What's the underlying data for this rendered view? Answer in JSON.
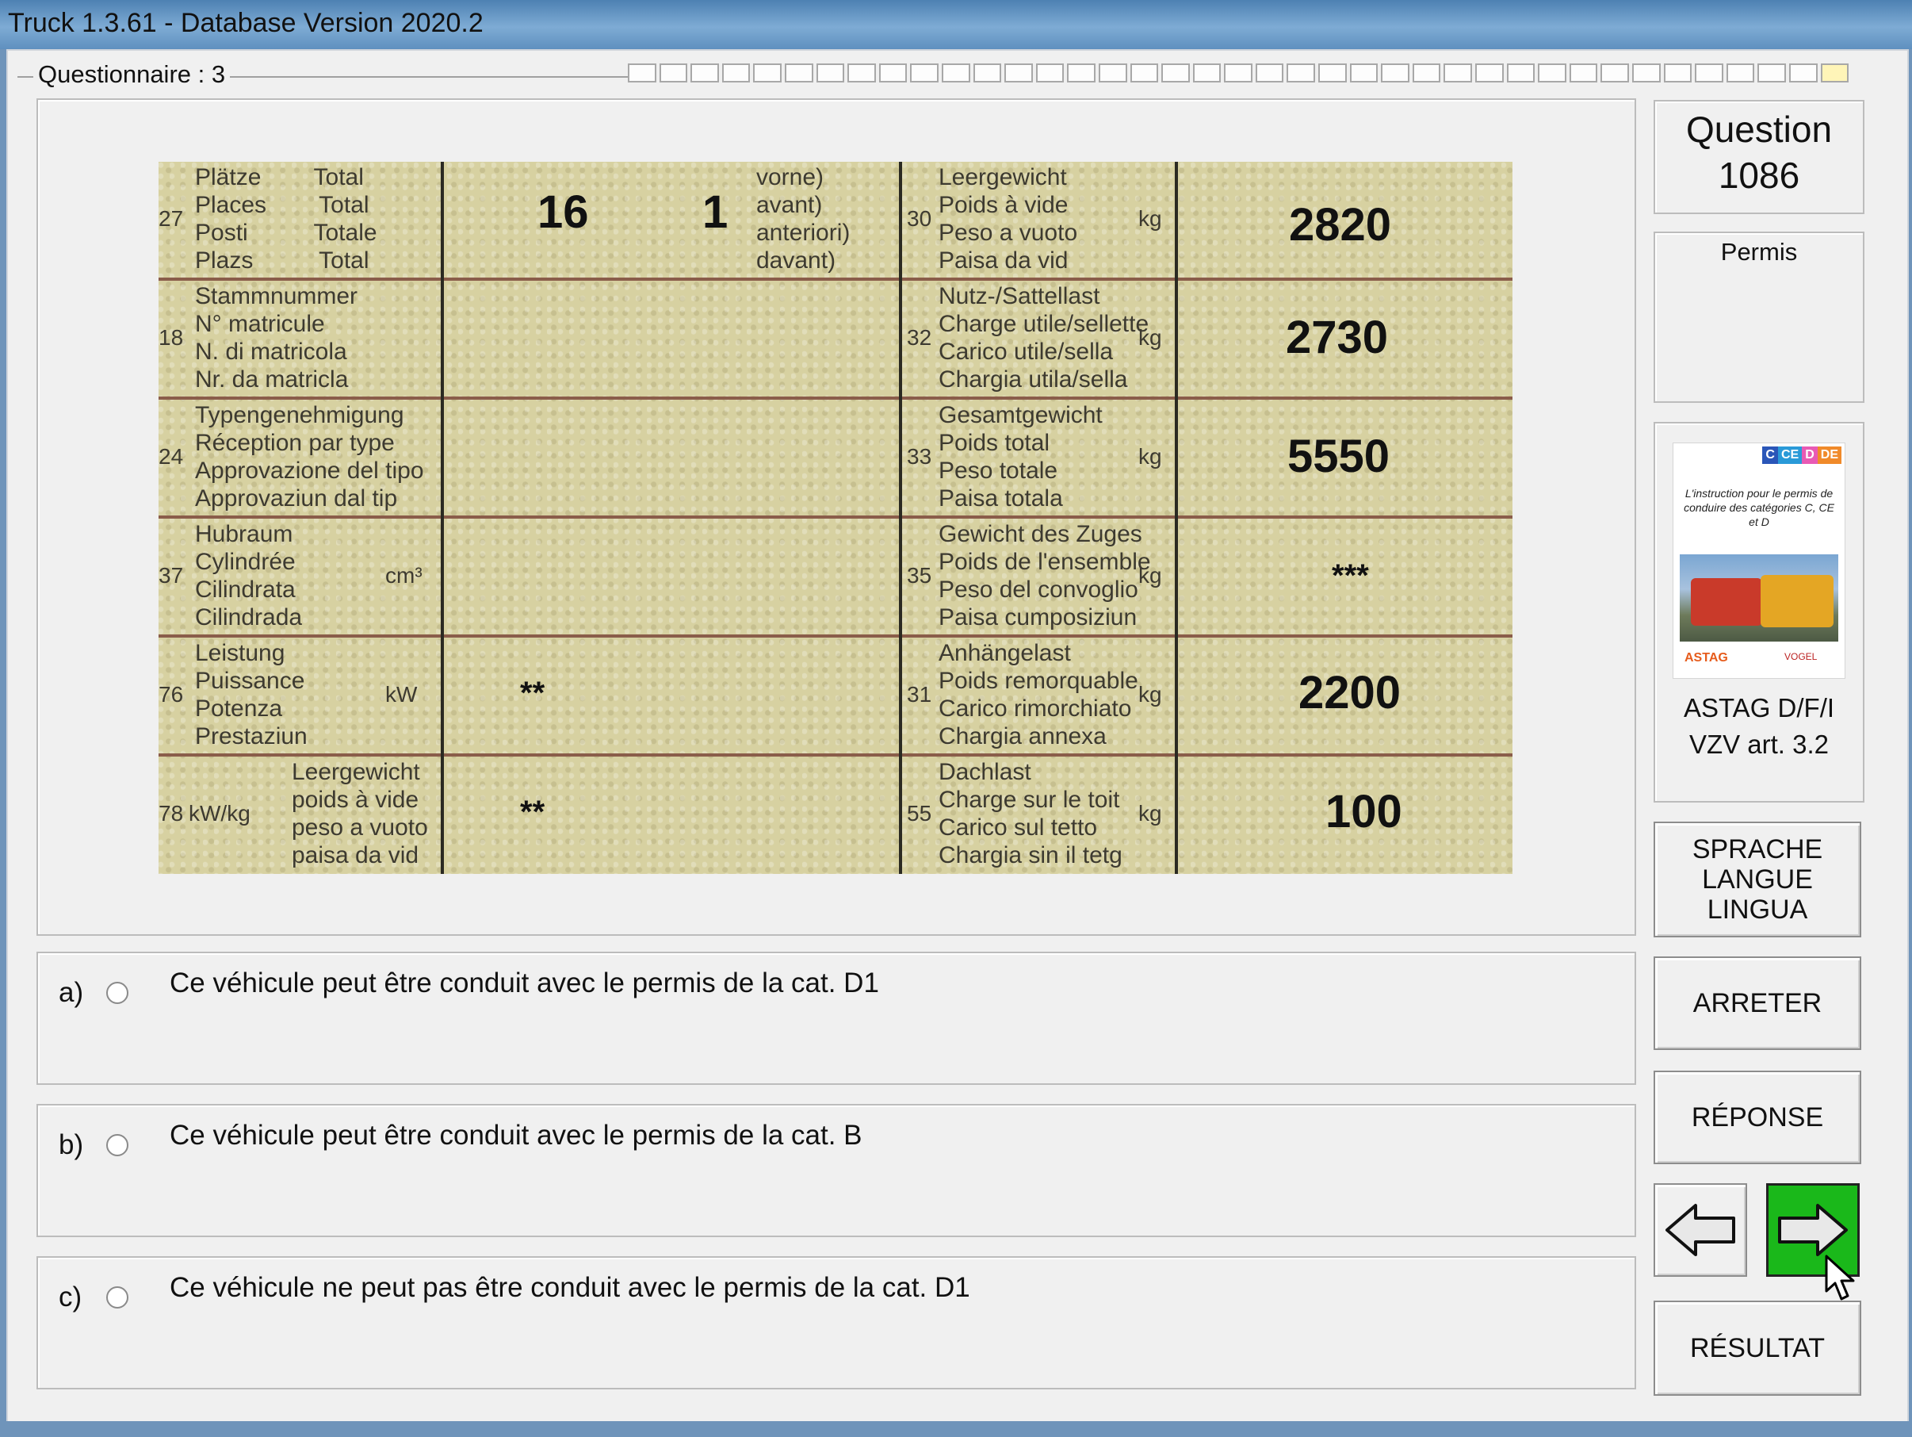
{
  "window": {
    "title": "Truck 1.3.61 - Database Version 2020.2"
  },
  "questionnaire": {
    "label": "Questionnaire : 3",
    "progress_total": 39,
    "progress_done": 1
  },
  "document": {
    "rows": [
      {
        "num": "27",
        "label": "Plätze        Total\nPlaces        Total\nPosti          Totale\nPlazs          Total",
        "value_a": "16",
        "value_b": "1",
        "value_b_label": "vorne)\navant)\nanteriori)\ndavant)",
        "num_r": "30",
        "label_r": "Leergewicht\nPoids à vide\nPeso a vuoto\nPaisa da vid",
        "unit_r": "kg",
        "value_r": "2820"
      },
      {
        "num": "18",
        "label": "Stammnummer\nN° matricule\nN. di matricola\nNr. da matricla",
        "num_r": "32",
        "label_r": "Nutz-/Sattellast\nCharge utile/sellette\nCarico utile/sella\nChargia utila/sella",
        "unit_r": "kg",
        "value_r": "2730"
      },
      {
        "num": "24",
        "label": "Typengenehmigung\nRéception par type\nApprovazione del tipo\nApprovaziun dal tip",
        "num_r": "33",
        "label_r": "Gesamtgewicht\nPoids total\nPeso totale\nPaisa totala",
        "unit_r": "kg",
        "value_r": "5550"
      },
      {
        "num": "37",
        "label": "Hubraum\nCylindrée\nCilindrata\nCilindrada",
        "unit": "cm³",
        "num_r": "35",
        "label_r": "Gewicht des Zuges\nPoids de l'ensemble\nPeso del convoglio\nPaisa cumposiziun",
        "unit_r": "kg",
        "value_r": "***"
      },
      {
        "num": "76",
        "label": "Leistung\nPuissance\nPotenza\nPrestaziun",
        "unit": "kW",
        "value_a": "**",
        "num_r": "31",
        "label_r": "Anhängelast\nPoids remorquable\nCarico rimorchiato\nChargia annexa",
        "unit_r": "kg",
        "value_r": "2200"
      },
      {
        "num": "78",
        "label_prefix": "kW/kg",
        "label": "Leergewicht\npoids à vide\npeso a vuoto\npaisa da vid",
        "value_a": "**",
        "num_r": "55",
        "label_r": "Dachlast\nCharge sur le toit\nCarico sul tetto\nChargia sin il tetg",
        "unit_r": "kg",
        "value_r": "100"
      }
    ]
  },
  "answers": [
    {
      "letter": "a)",
      "text": "Ce véhicule peut être conduit avec le permis de la cat. D1"
    },
    {
      "letter": "b)",
      "text": "Ce véhicule peut être conduit avec le permis de la cat. B"
    },
    {
      "letter": "c)",
      "text": "Ce véhicule ne peut pas être conduit avec le permis de la cat. D1"
    }
  ],
  "sidebar": {
    "question_label": "Question",
    "question_number": "1086",
    "category_label": "Permis",
    "book": {
      "badges": [
        "C",
        "CE",
        "D",
        "DE"
      ],
      "badge_colors": [
        "#2a56b8",
        "#2a9ad8",
        "#e85ab4",
        "#f08a2a"
      ],
      "text": "L'instruction pour le permis de conduire des catégories C, CE et D",
      "logo_left": "ASTAG",
      "logo_right": "VOGEL"
    },
    "source_line1": "ASTAG D/F/I",
    "source_line2": "VZV art. 3.2",
    "language_button": [
      "SPRACHE",
      "LANGUE",
      "LINGUA"
    ],
    "stop_button": "ARRETER",
    "answer_button": "RÉPONSE",
    "result_button": "RÉSULTAT",
    "prev_icon": "arrow-left-icon",
    "next_icon": "arrow-right-icon"
  }
}
